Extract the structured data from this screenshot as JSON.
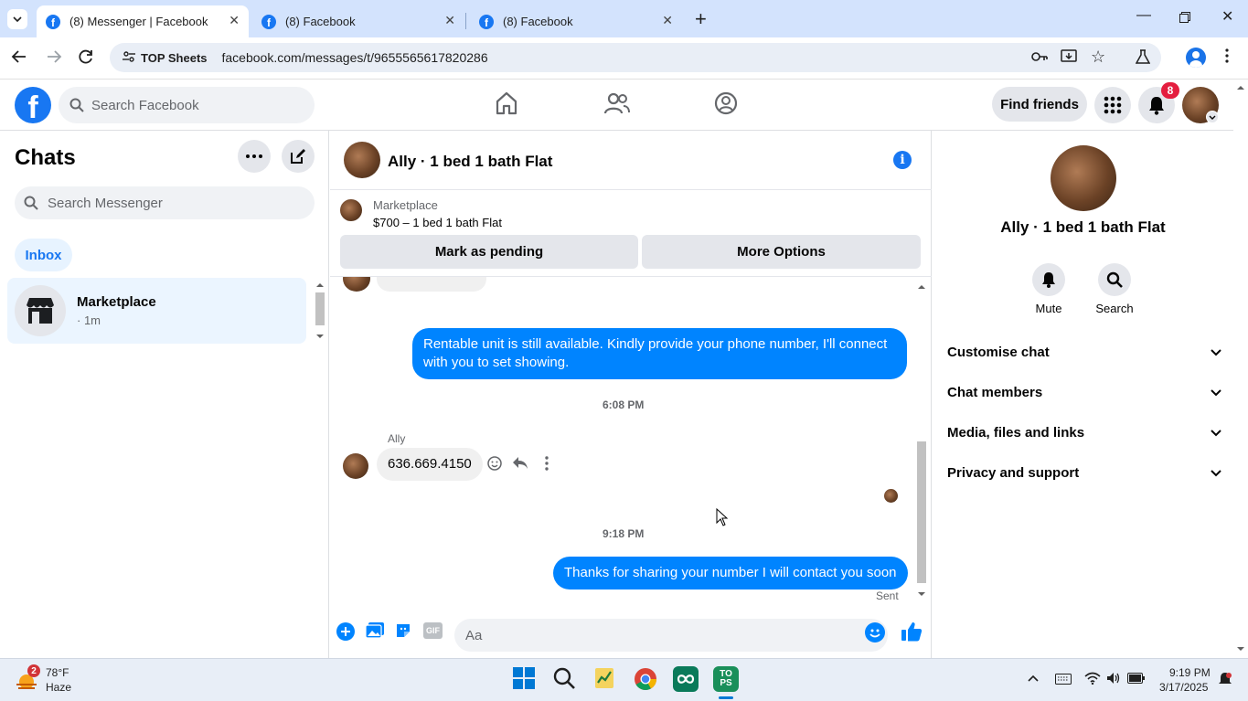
{
  "browser": {
    "tabs": [
      {
        "title": "(8) Messenger | Facebook",
        "active": true
      },
      {
        "title": "(8) Facebook",
        "active": false
      },
      {
        "title": "(8) Facebook",
        "active": false
      }
    ],
    "bookmark_chip": "TOP Sheets",
    "url": "facebook.com/messages/t/9655565617820286"
  },
  "fb_header": {
    "search_placeholder": "Search Facebook",
    "find_friends": "Find friends",
    "notification_count": "8"
  },
  "left_panel": {
    "title": "Chats",
    "search_placeholder": "Search Messenger",
    "inbox_label": "Inbox",
    "chats": [
      {
        "name": "Marketplace",
        "meta": "· 1m"
      }
    ]
  },
  "conversation": {
    "title": "Ally · 1 bed 1 bath Flat",
    "marketplace_label": "Marketplace",
    "listing": "$700 – 1 bed 1 bath Flat",
    "mark_pending": "Mark as pending",
    "more_options": "More Options",
    "messages": [
      {
        "from": "me",
        "text": "Rentable unit is still available. Kindly provide your phone number, I'll connect with you to set showing."
      },
      {
        "timestamp": "6:08 PM"
      },
      {
        "from": "them",
        "sender": "Ally",
        "text": "636.669.4150"
      },
      {
        "timestamp": "9:18 PM"
      },
      {
        "from": "me",
        "text": "Thanks for sharing your number I will contact you soon",
        "status": "Sent"
      }
    ],
    "composer_placeholder": "Aa"
  },
  "right_panel": {
    "name": "Ally · 1 bed 1 bath Flat",
    "actions": [
      "Mute",
      "Search"
    ],
    "sections": [
      "Customise chat",
      "Chat members",
      "Media, files and links",
      "Privacy and support"
    ]
  },
  "taskbar": {
    "weather_temp": "78°F",
    "weather_desc": "Haze",
    "weather_badge": "2",
    "time": "9:19 PM",
    "date": "3/17/2025"
  },
  "colors": {
    "fb_blue": "#1877f2",
    "bubble_blue": "#0084ff",
    "selected_chat_bg": "#ebf5ff"
  }
}
